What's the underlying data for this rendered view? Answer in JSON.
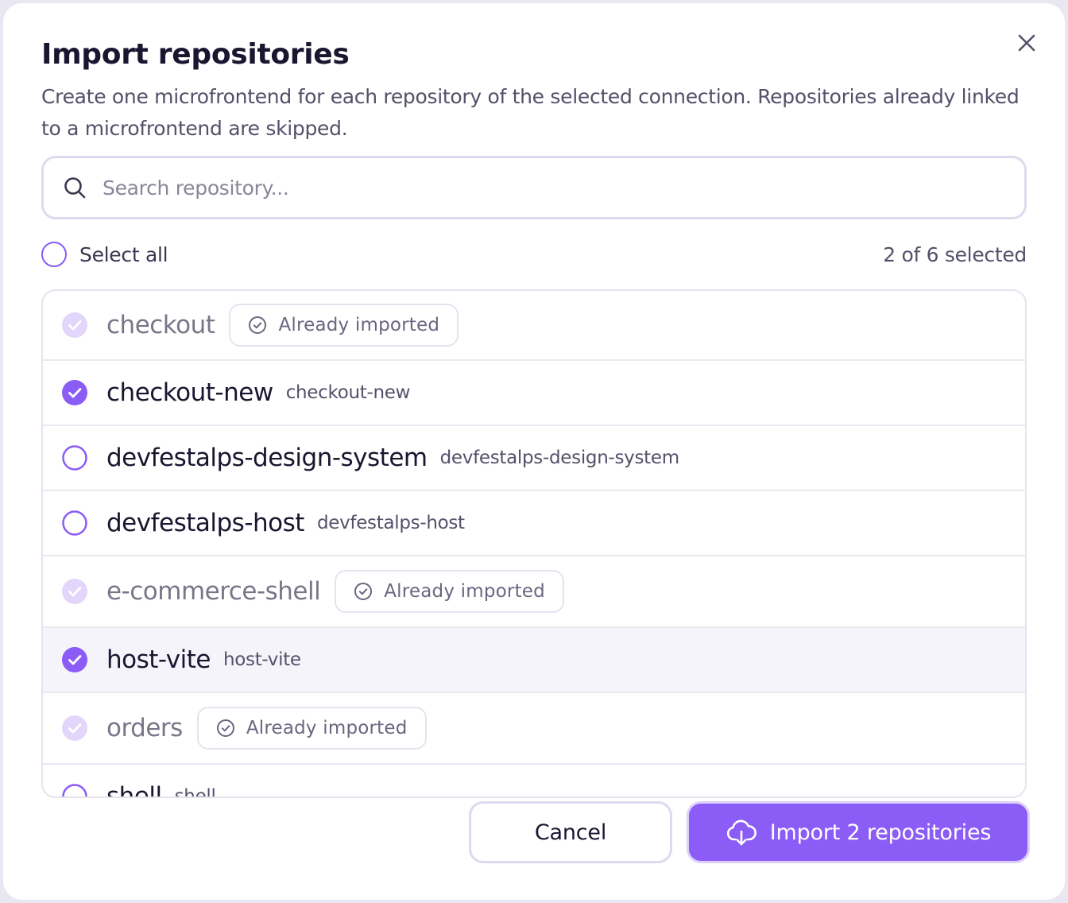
{
  "dialog": {
    "title": "Import repositories",
    "description": "Create one microfrontend for each repository of the selected connection. Repositories already linked to a microfrontend are skipped.",
    "close_icon": "close-icon"
  },
  "search": {
    "placeholder": "Search repository...",
    "value": "",
    "icon": "search-icon"
  },
  "selection": {
    "select_all_label": "Select all",
    "count_text": "2 of 6 selected"
  },
  "repositories": [
    {
      "name": "checkout",
      "slug": "",
      "state": "imported",
      "badge": "Already imported"
    },
    {
      "name": "checkout-new",
      "slug": "checkout-new",
      "state": "checked",
      "badge": ""
    },
    {
      "name": "devfestalps-design-system",
      "slug": "devfestalps-design-system",
      "state": "unchecked",
      "badge": ""
    },
    {
      "name": "devfestalps-host",
      "slug": "devfestalps-host",
      "state": "unchecked",
      "badge": ""
    },
    {
      "name": "e-commerce-shell",
      "slug": "",
      "state": "imported",
      "badge": "Already imported"
    },
    {
      "name": "host-vite",
      "slug": "host-vite",
      "state": "checked",
      "badge": "",
      "highlighted": true
    },
    {
      "name": "orders",
      "slug": "",
      "state": "imported",
      "badge": "Already imported"
    },
    {
      "name": "shell",
      "slug": "shell",
      "state": "unchecked",
      "badge": ""
    }
  ],
  "actions": {
    "cancel_label": "Cancel",
    "import_label": "Import 2 repositories",
    "import_icon": "cloud-download-icon"
  },
  "colors": {
    "accent": "#8b5cf6",
    "accent_muted": "#e2d6fb",
    "border": "#e6e3ef",
    "highlight_row": "#f6f4fb"
  }
}
